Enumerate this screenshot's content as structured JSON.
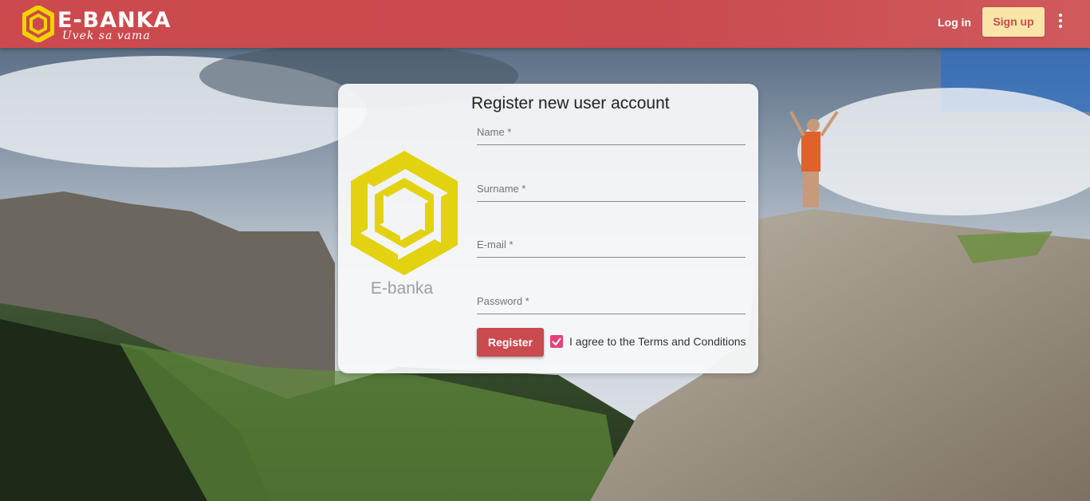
{
  "header": {
    "brand_name": "E-BANKA",
    "brand_tagline": "Uvek sa vama",
    "login_label": "Log in",
    "signup_label": "Sign up",
    "more_icon": "more-vert-icon"
  },
  "card": {
    "logo_text": "E-banka",
    "title": "Register new user account",
    "fields": [
      {
        "label": "Name *",
        "value": ""
      },
      {
        "label": "Surname *",
        "value": ""
      },
      {
        "label": "E-mail *",
        "value": ""
      },
      {
        "label": "Password *",
        "value": ""
      }
    ],
    "register_label": "Register",
    "agree_checked": true,
    "agree_label": "I agree to the Terms and Conditions"
  },
  "colors": {
    "header": "#c94a4f",
    "signup_bg": "#fae5a8",
    "logo_yellow": "#e3d20f",
    "checkbox": "#e6407a"
  }
}
